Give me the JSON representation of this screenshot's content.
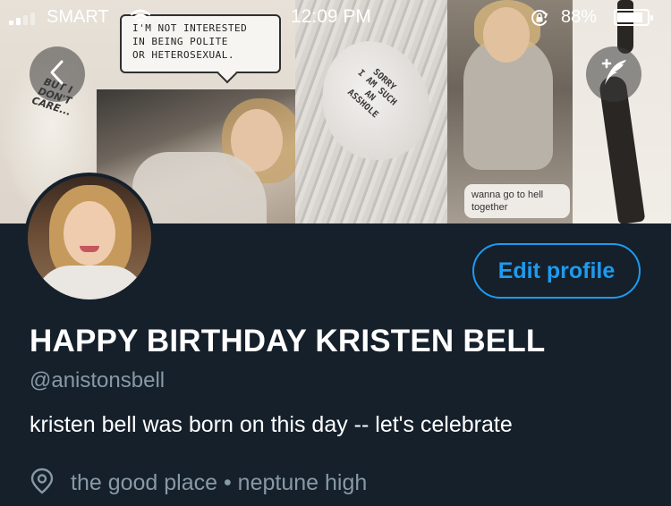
{
  "status_bar": {
    "carrier": "SMART",
    "time": "12:09 PM",
    "battery_percent": "88%",
    "battery_level": 0.88,
    "signal_bars_filled": 2,
    "signal_bars_total": 4
  },
  "header": {
    "back_icon": "chevron-left-icon",
    "compose_icon": "compose-tweet-icon",
    "banner_texts": {
      "balloon_left": "BUT I\nDON'T\nCARE...",
      "speech_box": "I'M NOT INTERESTED\nIN BEING POLITE\nOR HETEROSEXUAL.",
      "balloon_sorry": "SORRY\nI AM SUCH\nAN\nASSHOLE",
      "message_bubble": "wanna go to hell together"
    }
  },
  "profile": {
    "edit_label": "Edit profile",
    "display_name": "HAPPY BIRTHDAY KRISTEN BELL",
    "handle": "@anistonsbell",
    "bio": "kristen bell was born on this day -- let's celebrate",
    "location": "the good place • neptune high",
    "location_icon": "location-pin-icon"
  },
  "colors": {
    "background": "#15202b",
    "accent": "#1d9bf0",
    "secondary_text": "#8899a6",
    "primary_text": "#ffffff"
  }
}
